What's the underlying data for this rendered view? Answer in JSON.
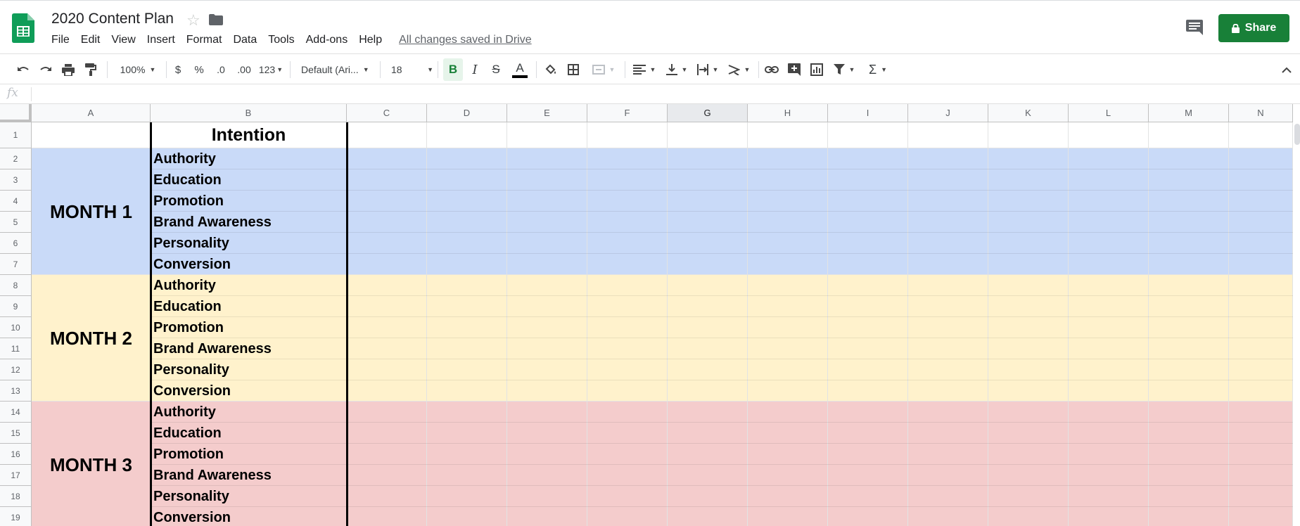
{
  "app": {
    "doc_title": "2020 Content Plan",
    "menus": [
      "File",
      "Edit",
      "View",
      "Insert",
      "Format",
      "Data",
      "Tools",
      "Add-ons",
      "Help"
    ],
    "save_status": "All changes saved in Drive",
    "share_label": "Share"
  },
  "toolbar": {
    "zoom": "100%",
    "currency": "$",
    "percent": "%",
    "dec_less": ".0",
    "dec_more": ".00",
    "num_format": "123",
    "font": "Default (Ari...",
    "font_size": "18",
    "bold": "B",
    "italic": "I",
    "strike": "S",
    "text_color": "A"
  },
  "formula_bar": {
    "fx": "fx",
    "value": ""
  },
  "sheet": {
    "columns": [
      "A",
      "B",
      "C",
      "D",
      "E",
      "F",
      "G",
      "H",
      "I",
      "J",
      "K",
      "L",
      "M",
      "N"
    ],
    "selected_column": "G",
    "rows": [
      "1",
      "2",
      "3",
      "4",
      "5",
      "6",
      "7",
      "8",
      "9",
      "10",
      "11",
      "12",
      "13",
      "14",
      "15",
      "16",
      "17",
      "18",
      "19"
    ],
    "header_b": "Intention",
    "groups": [
      {
        "label": "MONTH 1",
        "color": "#c9daf8",
        "items": [
          "Authority",
          "Education",
          "Promotion",
          "Brand Awareness",
          "Personality",
          "Conversion"
        ]
      },
      {
        "label": "MONTH 2",
        "color": "#fff2cc",
        "items": [
          "Authority",
          "Education",
          "Promotion",
          "Brand Awareness",
          "Personality",
          "Conversion"
        ]
      },
      {
        "label": "MONTH 3",
        "color": "#f4cccc",
        "items": [
          "Authority",
          "Education",
          "Promotion",
          "Brand Awareness",
          "Personality",
          "Conversion"
        ]
      }
    ]
  },
  "colors": {
    "brand_green": "#188038",
    "sheets_green": "#0f9d58"
  }
}
